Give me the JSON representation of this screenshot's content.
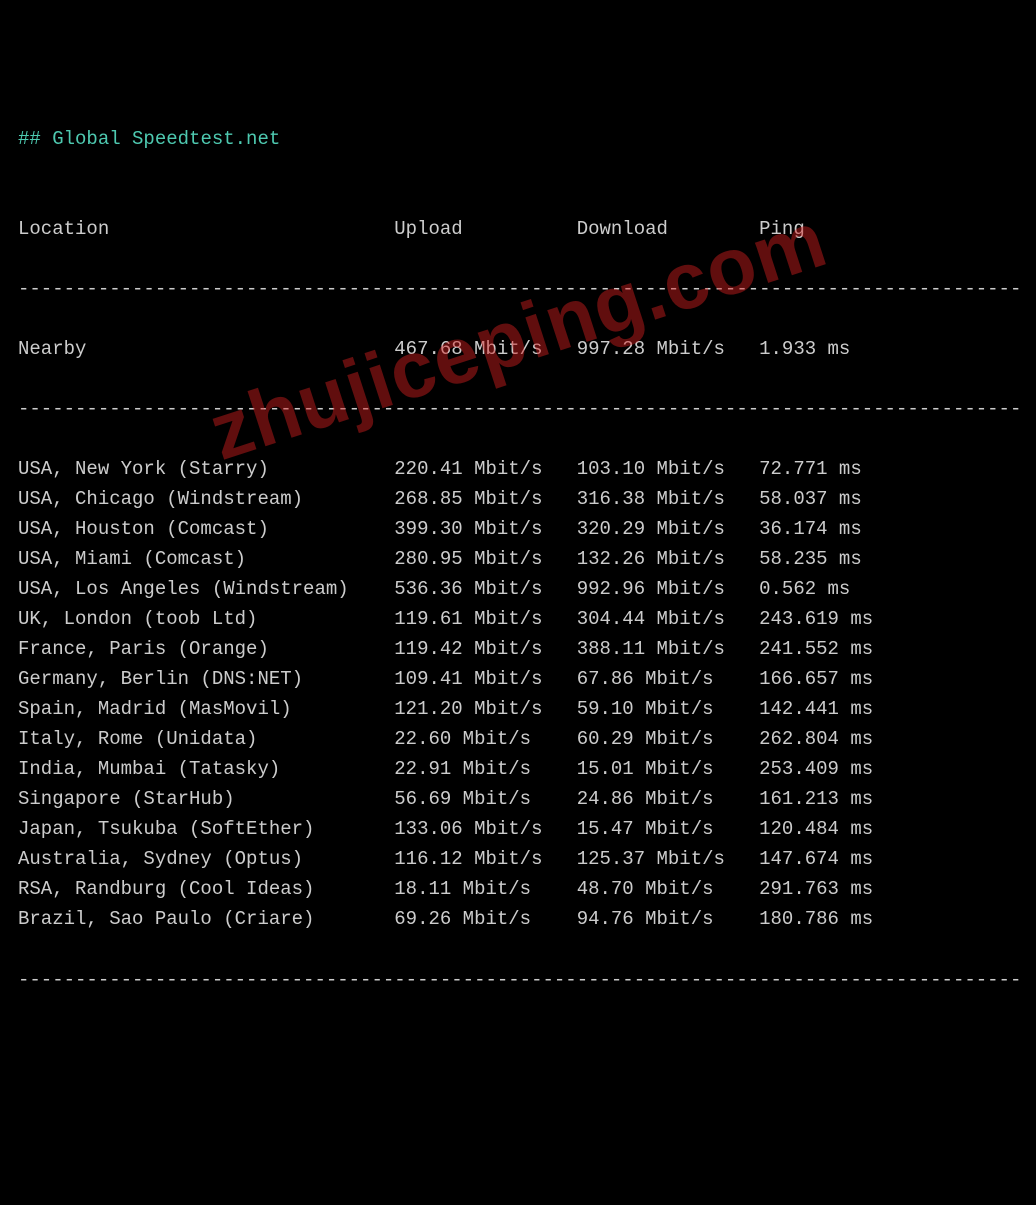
{
  "title_prefix": "## ",
  "title": "Global Speedtest.net",
  "headers": {
    "location": "Location",
    "upload": "Upload",
    "download": "Download",
    "ping": "Ping"
  },
  "nearby": {
    "location": "Nearby",
    "upload": "467.68 Mbit/s",
    "download": "997.28 Mbit/s",
    "ping": "1.933 ms"
  },
  "rows": [
    {
      "location": "USA, New York (Starry)",
      "upload": "220.41 Mbit/s",
      "download": "103.10 Mbit/s",
      "ping": "72.771 ms"
    },
    {
      "location": "USA, Chicago (Windstream)",
      "upload": "268.85 Mbit/s",
      "download": "316.38 Mbit/s",
      "ping": "58.037 ms"
    },
    {
      "location": "USA, Houston (Comcast)",
      "upload": "399.30 Mbit/s",
      "download": "320.29 Mbit/s",
      "ping": "36.174 ms"
    },
    {
      "location": "USA, Miami (Comcast)",
      "upload": "280.95 Mbit/s",
      "download": "132.26 Mbit/s",
      "ping": "58.235 ms"
    },
    {
      "location": "USA, Los Angeles (Windstream)",
      "upload": "536.36 Mbit/s",
      "download": "992.96 Mbit/s",
      "ping": "0.562 ms"
    },
    {
      "location": "UK, London (toob Ltd)",
      "upload": "119.61 Mbit/s",
      "download": "304.44 Mbit/s",
      "ping": "243.619 ms"
    },
    {
      "location": "France, Paris (Orange)",
      "upload": "119.42 Mbit/s",
      "download": "388.11 Mbit/s",
      "ping": "241.552 ms"
    },
    {
      "location": "Germany, Berlin (DNS:NET)",
      "upload": "109.41 Mbit/s",
      "download": "67.86 Mbit/s",
      "ping": "166.657 ms"
    },
    {
      "location": "Spain, Madrid (MasMovil)",
      "upload": "121.20 Mbit/s",
      "download": "59.10 Mbit/s",
      "ping": "142.441 ms"
    },
    {
      "location": "Italy, Rome (Unidata)",
      "upload": "22.60 Mbit/s",
      "download": "60.29 Mbit/s",
      "ping": "262.804 ms"
    },
    {
      "location": "India, Mumbai (Tatasky)",
      "upload": "22.91 Mbit/s",
      "download": "15.01 Mbit/s",
      "ping": "253.409 ms"
    },
    {
      "location": "Singapore (StarHub)",
      "upload": "56.69 Mbit/s",
      "download": "24.86 Mbit/s",
      "ping": "161.213 ms"
    },
    {
      "location": "Japan, Tsukuba (SoftEther)",
      "upload": "133.06 Mbit/s",
      "download": "15.47 Mbit/s",
      "ping": "120.484 ms"
    },
    {
      "location": "Australia, Sydney (Optus)",
      "upload": "116.12 Mbit/s",
      "download": "125.37 Mbit/s",
      "ping": "147.674 ms"
    },
    {
      "location": "RSA, Randburg (Cool Ideas)",
      "upload": "18.11 Mbit/s",
      "download": "48.70 Mbit/s",
      "ping": "291.763 ms"
    },
    {
      "location": "Brazil, Sao Paulo (Criare)",
      "upload": "69.26 Mbit/s",
      "download": "94.76 Mbit/s",
      "ping": "180.786 ms"
    }
  ],
  "watermark": "zhujiceping.com",
  "col_widths": {
    "location": 33,
    "upload": 16,
    "download": 16
  },
  "divider_len": 88
}
